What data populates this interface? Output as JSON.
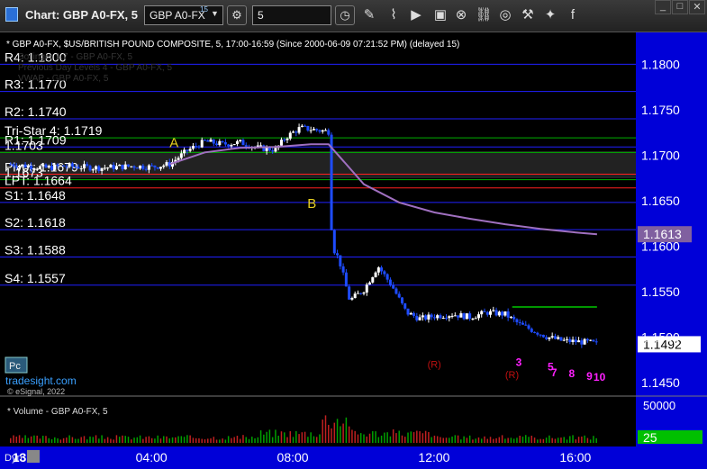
{
  "window": {
    "title": "Chart: GBP A0-FX, 5",
    "symbol": "GBP A0-FX",
    "symbol_sup": "15",
    "interval": "5"
  },
  "chart_header": "* GBP A0-FX, $US/BRITISH POUND COMPOSITE, 5, 17:00-16:59 (Since 2000-06-09 07:21:52 PM) (delayed 15)",
  "ghost_legend": [
    "Bollinger 1.7 - GBP A0-FX, 5",
    "Previous Day Levels 4 - GBP A0-FX, 5",
    "VWAP - GBP A0-FX, 5"
  ],
  "volume_header": "* Volume - GBP A0-FX, 5",
  "watermark": {
    "site": "tradesight.com",
    "copyright": "© eSignal, 2022",
    "badge": "Pc"
  },
  "colors": {
    "price_axis_bg": "#0000d8",
    "level_line": "#2020ff",
    "candle_up": "#ffffff",
    "candle_down": "#1e4cff",
    "vwap": "#a070c0",
    "pivot_red": "#ff2020",
    "green": "#00c800",
    "magenta": "#ff20ff"
  },
  "chart_data": {
    "type": "candlestick",
    "y_ticks": [
      "1.1800",
      "1.1750",
      "1.1700",
      "1.1650",
      "1.1600",
      "1.1550",
      "1.1500",
      "1.1450"
    ],
    "ylim": [
      1.1435,
      1.1835
    ],
    "x_ticks": [
      "13",
      "04:00",
      "08:00",
      "12:00",
      "16:00"
    ],
    "current_price": "1.1492",
    "vwap_last": "1.1613",
    "levels": [
      {
        "label": "R4: 1.1800",
        "value": 1.18
      },
      {
        "label": "R3: 1.1770",
        "value": 1.177
      },
      {
        "label": "R2: 1.1740",
        "value": 1.174
      },
      {
        "label": "Tri-Star 4: 1.1719",
        "value": 1.1719
      },
      {
        "label": "R1: 1.1709",
        "value": 1.1709
      },
      {
        "label": "1.1703",
        "value": 1.1703
      },
      {
        "label": "Pivot: 1.1679",
        "value": 1.1679
      },
      {
        "label": "1.1673",
        "value": 1.1673
      },
      {
        "label": "LPT: 1.1664",
        "value": 1.1664
      },
      {
        "label": "S1: 1.1648",
        "value": 1.1648
      },
      {
        "label": "S2: 1.1618",
        "value": 1.1618
      },
      {
        "label": "S3: 1.1588",
        "value": 1.1588
      },
      {
        "label": "S4: 1.1557",
        "value": 1.1557
      }
    ],
    "annotations": [
      {
        "text": "A",
        "time": 4.5
      },
      {
        "text": "B",
        "time": 8.4
      }
    ],
    "count_labels": [
      {
        "text": "3",
        "time": 14.3,
        "value": 1.1468
      },
      {
        "text": "5",
        "time": 15.2,
        "value": 1.1463
      },
      {
        "text": "7",
        "time": 15.3,
        "value": 1.1457
      },
      {
        "text": "8",
        "time": 15.8,
        "value": 1.1456
      },
      {
        "text": "9",
        "time": 16.3,
        "value": 1.1453
      },
      {
        "text": "10",
        "time": 16.5,
        "value": 1.1452
      }
    ],
    "r_marks": [
      {
        "text": "(R)",
        "time": 11.8,
        "value": 1.1466
      },
      {
        "text": "(R)",
        "time": 14.0,
        "value": 1.1455
      }
    ],
    "volume_axis": [
      "50000",
      "25"
    ],
    "close_path": [
      [
        0.0,
        1.169
      ],
      [
        0.5,
        1.1688
      ],
      [
        1.0,
        1.1686
      ],
      [
        1.5,
        1.1688
      ],
      [
        2.0,
        1.1687
      ],
      [
        2.5,
        1.1686
      ],
      [
        3.0,
        1.1687
      ],
      [
        3.5,
        1.1688
      ],
      [
        4.0,
        1.1687
      ],
      [
        4.5,
        1.169
      ],
      [
        5.0,
        1.1705
      ],
      [
        5.5,
        1.1715
      ],
      [
        6.0,
        1.1712
      ],
      [
        6.5,
        1.1714
      ],
      [
        7.0,
        1.1708
      ],
      [
        7.5,
        1.1706
      ],
      [
        7.8,
        1.172
      ],
      [
        8.2,
        1.173
      ],
      [
        8.6,
        1.1728
      ],
      [
        9.0,
        1.1726
      ],
      [
        9.1,
        1.16
      ],
      [
        9.3,
        1.1585
      ],
      [
        9.6,
        1.154
      ],
      [
        10.0,
        1.1552
      ],
      [
        10.4,
        1.1578
      ],
      [
        10.8,
        1.1556
      ],
      [
        11.2,
        1.1527
      ],
      [
        11.6,
        1.152
      ],
      [
        12.0,
        1.1523
      ],
      [
        12.5,
        1.1525
      ],
      [
        13.0,
        1.1522
      ],
      [
        13.5,
        1.1527
      ],
      [
        14.0,
        1.1525
      ],
      [
        14.4,
        1.1514
      ],
      [
        14.8,
        1.1507
      ],
      [
        15.2,
        1.15
      ],
      [
        15.6,
        1.1496
      ],
      [
        16.0,
        1.1495
      ],
      [
        16.4,
        1.1494
      ],
      [
        16.6,
        1.1492
      ]
    ],
    "vwap_path": [
      [
        4.5,
        1.169
      ],
      [
        5.5,
        1.1703
      ],
      [
        6.5,
        1.1708
      ],
      [
        7.5,
        1.1709
      ],
      [
        8.5,
        1.1712
      ],
      [
        9.0,
        1.1712
      ],
      [
        9.5,
        1.169
      ],
      [
        10.0,
        1.1668
      ],
      [
        11.0,
        1.1648
      ],
      [
        12.0,
        1.1637
      ],
      [
        13.0,
        1.163
      ],
      [
        14.0,
        1.1624
      ],
      [
        15.0,
        1.1619
      ],
      [
        16.0,
        1.1615
      ],
      [
        16.6,
        1.1613
      ]
    ],
    "green_line": {
      "value": 1.1533,
      "from_time": 14.2,
      "to_time": 16.6
    }
  }
}
